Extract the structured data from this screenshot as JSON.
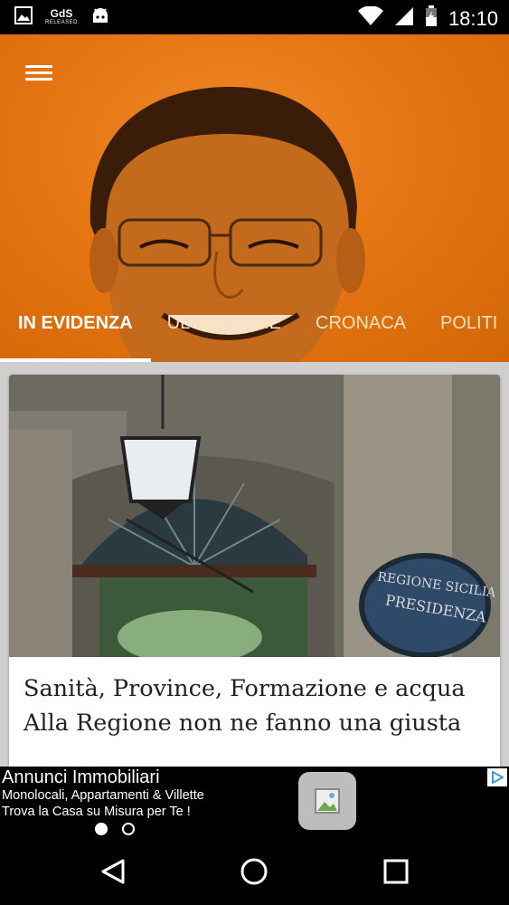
{
  "status_bar": {
    "app_badge": "GdS",
    "app_badge_sub": "RELEASED",
    "time": "18:10",
    "icons": [
      "image-icon",
      "gds-app-icon",
      "android-icon",
      "wifi-icon",
      "signal-icon",
      "battery-icon"
    ]
  },
  "header": {
    "menu_icon": "hamburger-menu-icon",
    "background_color": "#e67612",
    "tabs": [
      {
        "label": "IN EVIDENZA",
        "active": true
      },
      {
        "label": "ULTIMISSIME",
        "active": false
      },
      {
        "label": "CRONACA",
        "active": false
      },
      {
        "label": "POLITI",
        "active": false
      }
    ]
  },
  "article": {
    "title_line1": "Sanità, Province, Formazione e acqua",
    "title_line2": "Alla Regione non ne fanno una giusta",
    "sign_text_line1": "REGIONE SICILIA",
    "sign_text_line2": "PRESIDENZA"
  },
  "ad": {
    "headline": "Annunci Immobiliari",
    "line1": "Monolocali, Appartamenti & Villette",
    "line2": "Trova la Casa su Misura per Te !",
    "adchoices_icon": "adchoices-icon",
    "page_count": 2,
    "active_page": 1
  },
  "nav": {
    "back_icon": "back-icon",
    "home_icon": "home-icon",
    "recents_icon": "recents-icon"
  }
}
